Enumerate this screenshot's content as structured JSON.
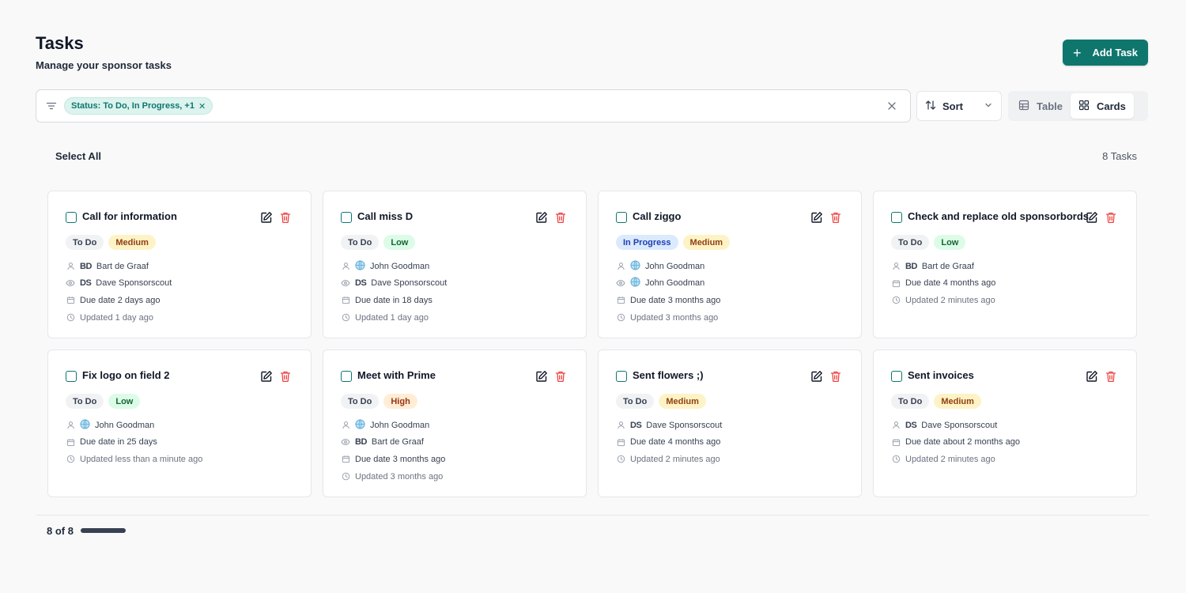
{
  "header": {
    "title": "Tasks",
    "subtitle": "Manage your sponsor tasks",
    "add_label": "Add Task"
  },
  "filter": {
    "chip_label": "Status: To Do, In Progress, +1"
  },
  "toolbar": {
    "sort_label": "Sort",
    "table_label": "Table",
    "cards_label": "Cards"
  },
  "list": {
    "select_all": "Select All",
    "count": "8 Tasks"
  },
  "cards": [
    {
      "title": "Call for information",
      "status": "To Do",
      "priority": "Medium",
      "assignee_initials": "BD",
      "assignee": "Bart de Graaf",
      "watcher_initials": "DS",
      "watcher": "Dave Sponsorscout",
      "due": "Due date 2 days ago",
      "updated": "Updated 1 day ago"
    },
    {
      "title": "Call miss D",
      "status": "To Do",
      "priority": "Low",
      "assignee": "John Goodman",
      "watcher_initials": "DS",
      "watcher": "Dave Sponsorscout",
      "due": "Due date in 18 days",
      "updated": "Updated 1 day ago"
    },
    {
      "title": "Call ziggo",
      "status": "In Progress",
      "priority": "Medium",
      "assignee": "John Goodman",
      "watcher": "John Goodman",
      "due": "Due date 3 months ago",
      "updated": "Updated 3 months ago"
    },
    {
      "title": "Check and replace old sponsorbords",
      "status": "To Do",
      "priority": "Low",
      "assignee_initials": "BD",
      "assignee": "Bart de Graaf",
      "due": "Due date 4 months ago",
      "updated": "Updated 2 minutes ago"
    },
    {
      "title": "Fix logo on field 2",
      "status": "To Do",
      "priority": "Low",
      "assignee": "John Goodman",
      "due": "Due date in 25 days",
      "updated": "Updated less than a minute ago"
    },
    {
      "title": "Meet with Prime",
      "status": "To Do",
      "priority": "High",
      "assignee": "John Goodman",
      "watcher_initials": "BD",
      "watcher": "Bart de Graaf",
      "due": "Due date 3 months ago",
      "updated": "Updated 3 months ago"
    },
    {
      "title": "Sent flowers ;)",
      "status": "To Do",
      "priority": "Medium",
      "assignee_initials": "DS",
      "assignee": "Dave Sponsorscout",
      "due": "Due date 4 months ago",
      "updated": "Updated 2 minutes ago"
    },
    {
      "title": "Sent invoices",
      "status": "To Do",
      "priority": "Medium",
      "assignee_initials": "DS",
      "assignee": "Dave Sponsorscout",
      "due": "Due date about 2 months ago",
      "updated": "Updated 2 minutes ago"
    }
  ],
  "pagination": {
    "label": "8 of 8"
  },
  "colors": {
    "accent": "#0f766e",
    "danger": "#ef4444"
  }
}
